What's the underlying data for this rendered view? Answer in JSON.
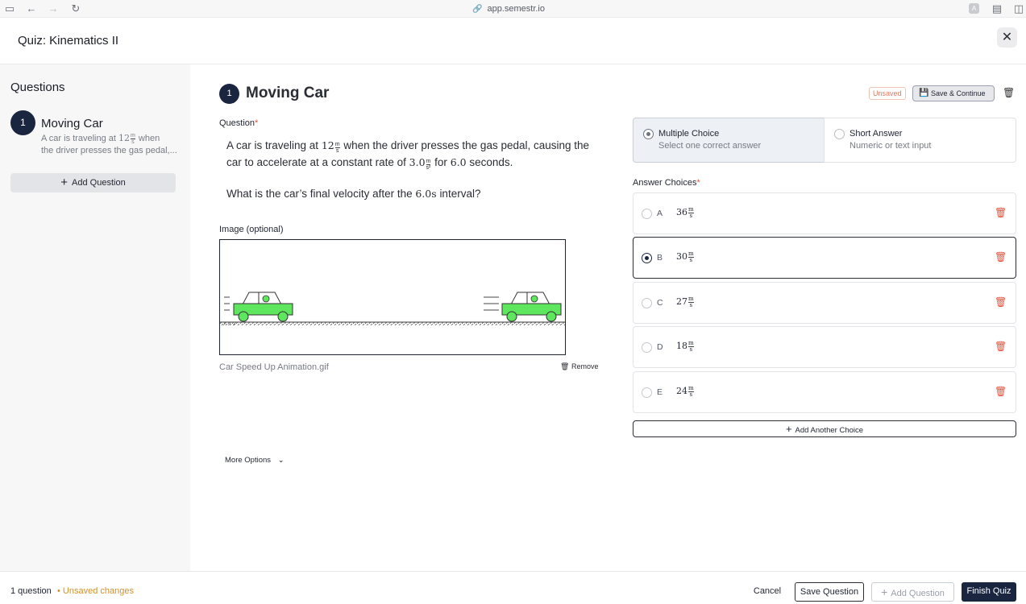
{
  "browser": {
    "url": "app.semestr.io"
  },
  "header": {
    "title": "Quiz: Kinematics II",
    "close_glyph": "✕"
  },
  "sidebar": {
    "heading": "Questions",
    "items": [
      {
        "number": "1",
        "title": "Moving Car",
        "desc_prefix": "A car is traveling at",
        "desc_value": "12",
        "desc_unit_num": "m",
        "desc_unit_den": "s",
        "desc_suffix": "when",
        "desc_line2": "the driver presses the gas pedal,..."
      }
    ],
    "add_label": "Add Question"
  },
  "editor": {
    "number": "1",
    "title": "Moving Car",
    "unsaved_tag": "Unsaved",
    "save_continue": "Save & Continue",
    "question_label": "Question",
    "required_mark": "*",
    "question": {
      "p1": "A car is traveling at",
      "v1": "12",
      "u1n": "m",
      "u1d": "s",
      "p2": "when the driver presses the gas pedal, causing the car to accelerate at a constant rate of",
      "v2": "3.0",
      "u2n": "m",
      "u2d": "s²",
      "p3": "for",
      "v3": "6.0",
      "p4": "seconds.",
      "line2_prefix": "What is the car’s final velocity after the",
      "line2_value": "6.0s",
      "line2_suffix": "interval?"
    },
    "image_label": "Image (optional)",
    "image_name": "Car Speed Up Animation.gif",
    "remove_label": "Remove",
    "more_options": "More Options"
  },
  "question_types": [
    {
      "title": "Multiple Choice",
      "subtitle": "Select one correct answer",
      "selected": true
    },
    {
      "title": "Short Answer",
      "subtitle": "Numeric or text input",
      "selected": false
    }
  ],
  "answers": {
    "label": "Answer Choices",
    "choices": [
      {
        "letter": "A",
        "value": "36",
        "un": "m",
        "ud": "s",
        "selected": false
      },
      {
        "letter": "B",
        "value": "30",
        "un": "m",
        "ud": "s",
        "selected": true
      },
      {
        "letter": "C",
        "value": "27",
        "un": "m",
        "ud": "s",
        "selected": false
      },
      {
        "letter": "D",
        "value": "18",
        "un": "m",
        "ud": "s",
        "selected": false
      },
      {
        "letter": "E",
        "value": "24",
        "un": "m",
        "ud": "s",
        "selected": false
      }
    ],
    "add_choice": "Add Another Choice"
  },
  "footer": {
    "count": "1 question",
    "unsaved": "• Unsaved changes",
    "cancel": "Cancel",
    "save_question": "Save Question",
    "add_question": "Add Question",
    "finish": "Finish Quiz"
  },
  "colors": {
    "navy": "#1a2540",
    "danger": "#e0533d",
    "warning": "#d4912a",
    "car": "#5ee65e"
  }
}
